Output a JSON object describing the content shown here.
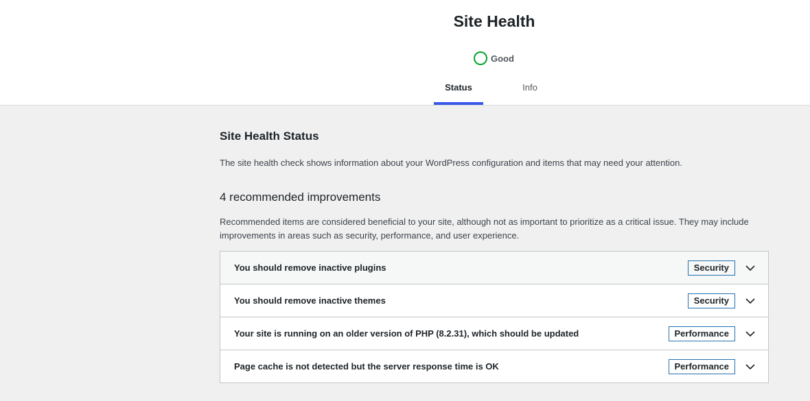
{
  "header": {
    "title": "Site Health",
    "rating": {
      "label": "Good",
      "color": "#00a32a"
    },
    "tabs": [
      {
        "label": "Status",
        "active": true
      },
      {
        "label": "Info",
        "active": false
      }
    ],
    "accent_color": "#3858e9"
  },
  "status": {
    "title": "Site Health Status",
    "description": "The site health check shows information about your WordPress configuration and items that may need your attention.",
    "recommended": {
      "count_label": "4 recommended improvements",
      "description": "Recommended items are considered beneficial to your site, although not as important to prioritize as a critical issue. They may include improvements in areas such as security, performance, and user experience.",
      "items": [
        {
          "title": "You should remove inactive plugins",
          "badge": "Security",
          "icon": "chevron-down-icon"
        },
        {
          "title": "You should remove inactive themes",
          "badge": "Security",
          "icon": "chevron-down-icon"
        },
        {
          "title": "Your site is running on an older version of PHP (8.2.31), which should be updated",
          "badge": "Performance",
          "icon": "chevron-down-icon"
        },
        {
          "title": "Page cache is not detected but the server response time is OK",
          "badge": "Performance",
          "icon": "chevron-down-icon"
        }
      ]
    }
  }
}
